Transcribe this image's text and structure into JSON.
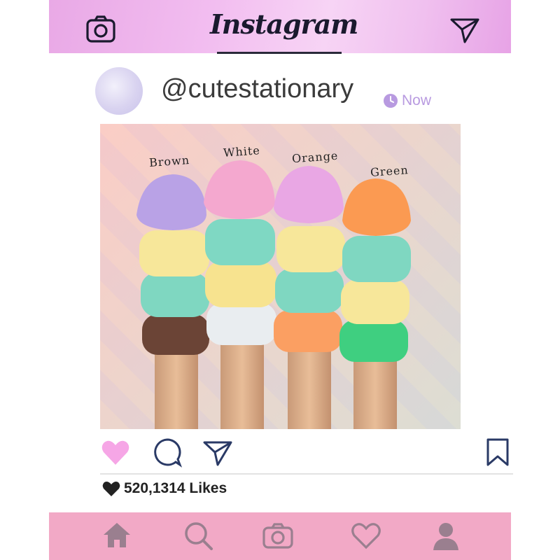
{
  "header": {
    "brand": "Instagram",
    "icons": [
      "camera-icon",
      "send-icon"
    ]
  },
  "post": {
    "username": "@cutestationary",
    "time_label": "Now",
    "photo": {
      "labels": [
        "Brown",
        "White",
        "Orange",
        "Green"
      ]
    },
    "actions": [
      "like-heart-icon",
      "comment-icon",
      "share-icon",
      "bookmark-icon"
    ],
    "likes_label": "520,1314 Likes"
  },
  "bottom_nav": [
    "home-icon",
    "search-icon",
    "camera-icon",
    "heart-icon",
    "profile-icon"
  ],
  "colors": {
    "header_gradient": "#f2bdf0",
    "bottom_bar": "#f2a9c6",
    "heart_pink": "#f6a6e6",
    "icon_gray": "#9a7f8f",
    "time_purple": "#b89ae0"
  }
}
